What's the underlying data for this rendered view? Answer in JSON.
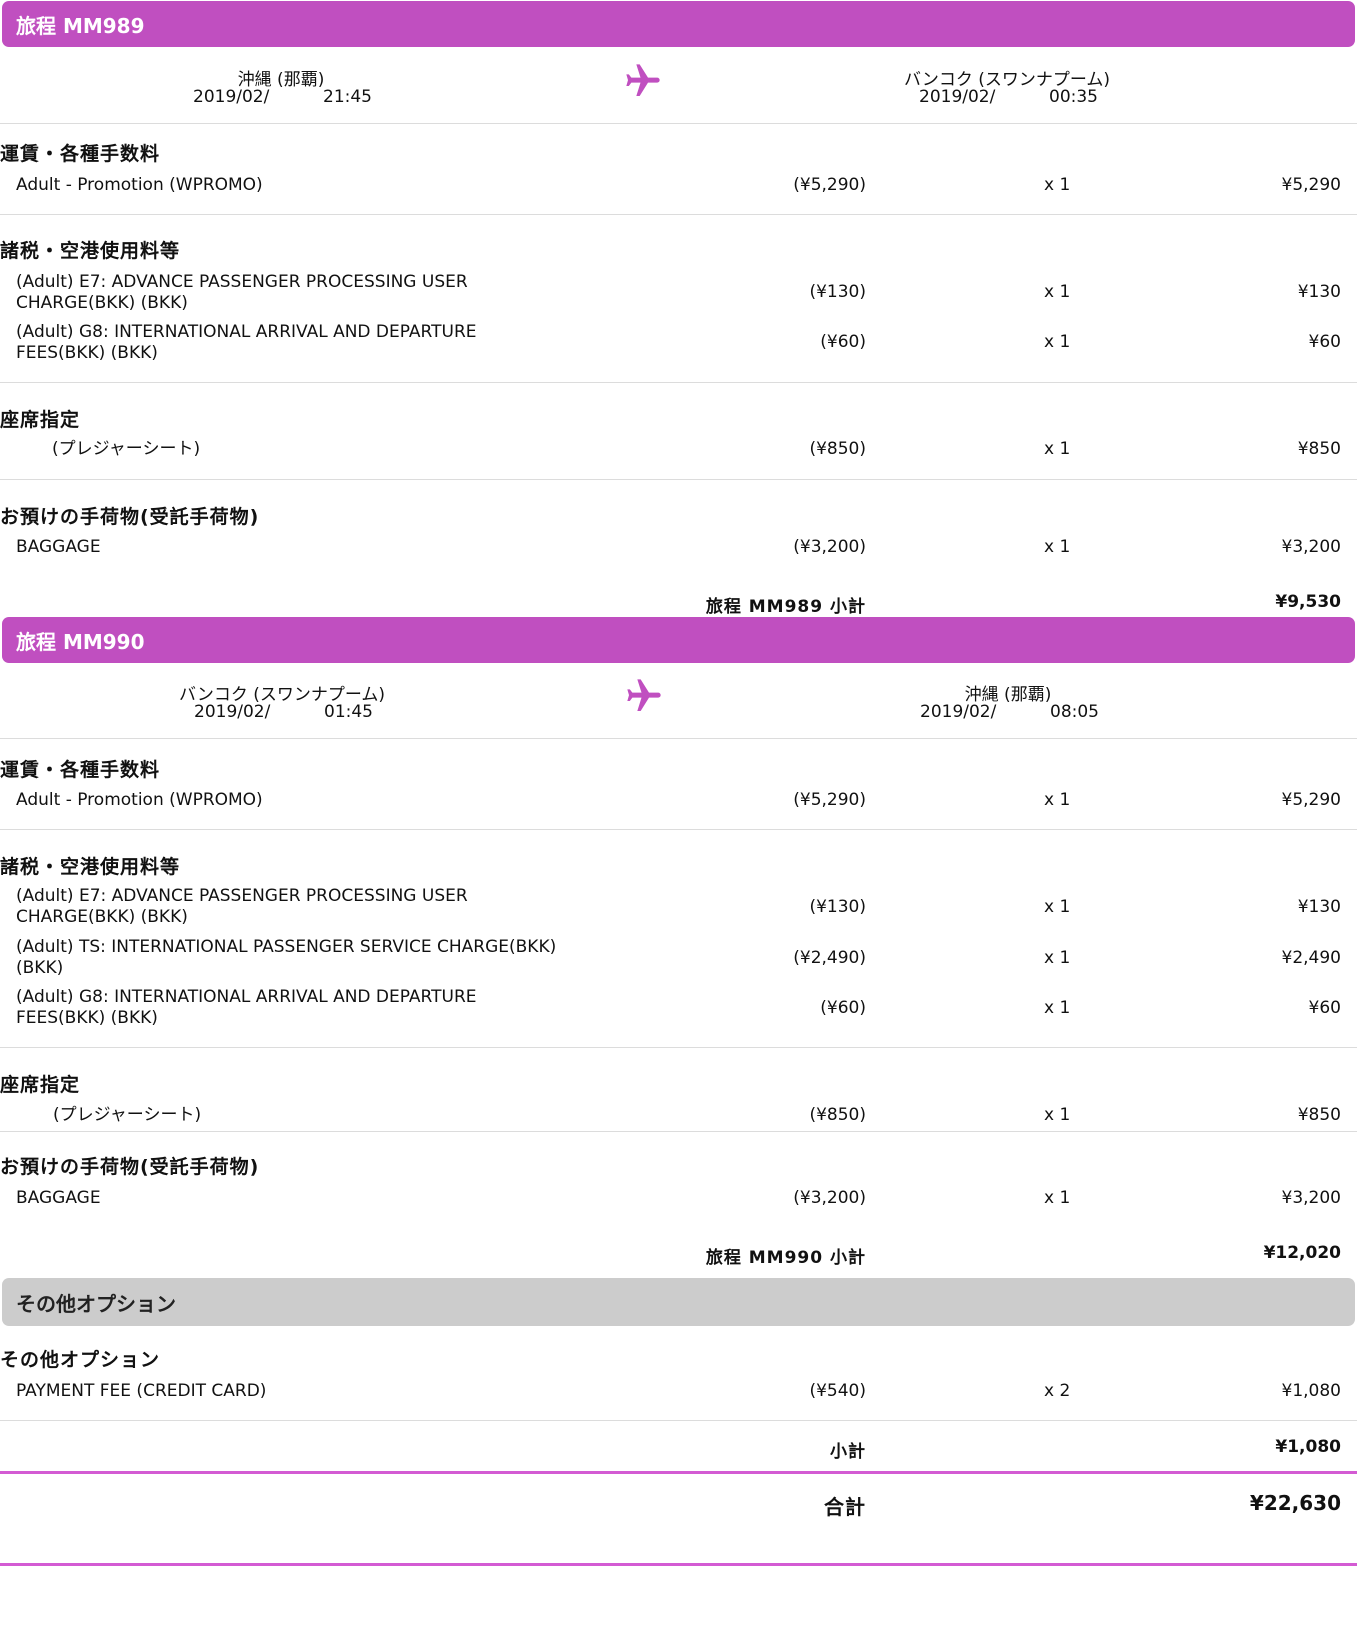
{
  "theme": {
    "accent": "#c04fc0",
    "gray_bar": "#cccccc"
  },
  "leg1": {
    "title": "旅程 MM989",
    "from_city": "沖縄 (那覇)",
    "from_date": "2019/02/",
    "from_time": "21:45",
    "to_city": "バンコク (スワンナプーム)",
    "to_date": "2019/02/",
    "to_time": "00:35",
    "plane_icon": "airplane-icon",
    "fare_title": "運賃・各種手数料",
    "fare": {
      "desc": "Adult - Promotion (WPROMO)",
      "unit": "(¥5,290)",
      "qty": "x 1",
      "amt": "¥5,290"
    },
    "tax_title": "諸税・空港使用料等",
    "taxes": [
      {
        "desc1": "(Adult) E7: ADVANCE PASSENGER PROCESSING USER",
        "desc2": "CHARGE(BKK) (BKK)",
        "unit": "(¥130)",
        "qty": "x 1",
        "amt": "¥130"
      },
      {
        "desc1": "(Adult) G8: INTERNATIONAL ARRIVAL AND DEPARTURE",
        "desc2": "FEES(BKK) (BKK)",
        "unit": "(¥60)",
        "qty": "x 1",
        "amt": "¥60"
      }
    ],
    "seat_title": "座席指定",
    "seat": {
      "desc": "(プレジャーシート)",
      "unit": "(¥850)",
      "qty": "x 1",
      "amt": "¥850"
    },
    "bag_title": "お預けの手荷物(受託手荷物)",
    "bag": {
      "desc": "BAGGAGE",
      "unit": "(¥3,200)",
      "qty": "x 1",
      "amt": "¥3,200"
    },
    "subtotal_label": "旅程 MM989 小計",
    "subtotal_value": "¥9,530"
  },
  "leg2": {
    "title": "旅程 MM990",
    "from_city": "バンコク (スワンナプーム)",
    "from_date": "2019/02/",
    "from_time": "01:45",
    "to_city": "沖縄 (那覇)",
    "to_date": "2019/02/",
    "to_time": "08:05",
    "plane_icon": "airplane-icon",
    "fare_title": "運賃・各種手数料",
    "fare": {
      "desc": "Adult - Promotion (WPROMO)",
      "unit": "(¥5,290)",
      "qty": "x 1",
      "amt": "¥5,290"
    },
    "tax_title": "諸税・空港使用料等",
    "taxes": [
      {
        "desc1": "(Adult) E7: ADVANCE PASSENGER PROCESSING USER",
        "desc2": "CHARGE(BKK) (BKK)",
        "unit": "(¥130)",
        "qty": "x 1",
        "amt": "¥130"
      },
      {
        "desc1": "(Adult) TS: INTERNATIONAL PASSENGER SERVICE CHARGE(BKK)",
        "desc2": "(BKK)",
        "unit": "(¥2,490)",
        "qty": "x 1",
        "amt": "¥2,490"
      },
      {
        "desc1": "(Adult) G8: INTERNATIONAL ARRIVAL AND DEPARTURE",
        "desc2": "FEES(BKK) (BKK)",
        "unit": "(¥60)",
        "qty": "x 1",
        "amt": "¥60"
      }
    ],
    "seat_title": "座席指定",
    "seat": {
      "desc": "(プレジャーシート)",
      "unit": "(¥850)",
      "qty": "x 1",
      "amt": "¥850"
    },
    "bag_title": "お預けの手荷物(受託手荷物)",
    "bag": {
      "desc": "BAGGAGE",
      "unit": "(¥3,200)",
      "qty": "x 1",
      "amt": "¥3,200"
    },
    "subtotal_label": "旅程 MM990 小計",
    "subtotal_value": "¥12,020"
  },
  "other": {
    "bar_title": "その他オプション",
    "section_title": "その他オプション",
    "item": {
      "desc": "PAYMENT FEE (CREDIT CARD)",
      "unit": "(¥540)",
      "qty": "x 2",
      "amt": "¥1,080"
    },
    "subtotal_label": "小計",
    "subtotal_value": "¥1,080"
  },
  "total": {
    "label": "合計",
    "value": "¥22,630"
  }
}
